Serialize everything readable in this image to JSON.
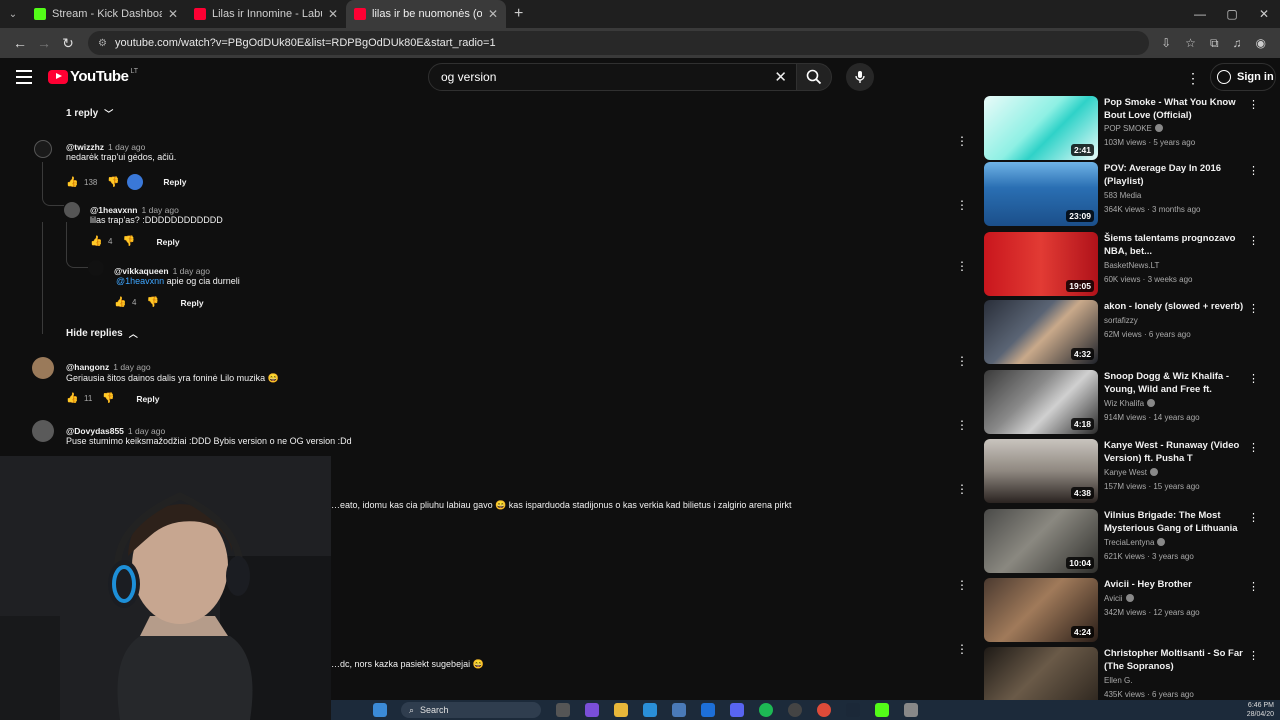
{
  "browser": {
    "tabs": [
      {
        "label": "Stream - Kick Dashboard",
        "fav_color": "#53fc18",
        "active": false
      },
      {
        "label": "Lilas ir Innomine - Labubu - You",
        "fav_color": "#ff0033",
        "active": false
      },
      {
        "label": "lilas ir be nuomonės (oficialus p",
        "fav_color": "#ff0033",
        "active": true
      }
    ],
    "url": "youtube.com/watch?v=PBgOdDUk80E&list=RDPBgOdDUk80E&start_radio=1"
  },
  "header": {
    "logo_text": "YouTube",
    "country_code": "LT",
    "search_value": "og version",
    "signin_label": "Sign in"
  },
  "comments": {
    "reply_toggle": "1 reply",
    "hide_replies": "Hide replies",
    "reply_label": "Reply",
    "items": [
      {
        "author": "@twizzhz",
        "time": "1 day ago",
        "text": "nedarėk trap'ui gėdos, ačiū.",
        "likes": "138"
      },
      {
        "author": "@1heavxnn",
        "time": "1 day ago",
        "text": "lilas trap'as? :DDDDDDDDDDDD",
        "likes": "4"
      },
      {
        "author": "@vikkaqueen",
        "time": "1 day ago",
        "mention": "@1heavxnn",
        "text": " apie og cia durneli",
        "likes": "4"
      },
      {
        "author": "@hangonz",
        "time": "1 day ago",
        "text": "Geriausia šitos dainos dalis yra foninė Lilo muzika 😄",
        "likes": "11"
      },
      {
        "author": "@Dovydas855",
        "time": "1 day ago",
        "text": "Puse stumimo keiksmažodžiai :DDD Bybis version o ne OG version :Dd"
      }
    ],
    "partial_1": "…eato, idomu kas cia pliuhu labiau gavo 😄 kas isparduoda stadijonus o kas verkia kad bilietus i zalgirio arena pirkt",
    "partial_2": "…dc, nors kazka pasiekt sugebejai 😄"
  },
  "sidebar": {
    "videos": [
      {
        "title": "Pop Smoke - What You Know Bout Love (Official)",
        "channel": "POP SMOKE",
        "verified": true,
        "meta": "103M views · 5 years ago",
        "duration": "2:41",
        "bg": "linear-gradient(135deg,#e9fbf9,#8ef0e4 45%,#2fd2c8 60%,#eafcfa)"
      },
      {
        "title": "POV: Average Day In 2016 (Playlist)",
        "channel": "583 Media",
        "verified": false,
        "meta": "364K views · 3 months ago",
        "duration": "23:09",
        "bg": "linear-gradient(180deg,#6fb3e6,#2a6fb3 40%,#1b4f8a)"
      },
      {
        "title": "Šiems talentams prognozavo NBA, bet...",
        "channel": "BasketNews.LT",
        "verified": false,
        "meta": "60K views · 3 weeks ago",
        "duration": "19:05",
        "bg": "linear-gradient(90deg,#c9161d,#e23b34 50%,#b0121a)"
      },
      {
        "title": "akon - lonely (slowed + reverb)",
        "channel": "sortafizzy",
        "verified": false,
        "meta": "62M views · 6 years ago",
        "duration": "4:32",
        "bg": "linear-gradient(135deg,#2a2f3a,#5a6474 40%,#c9a98a 55%,#1e222a)"
      },
      {
        "title": "Snoop Dogg & Wiz Khalifa - Young, Wild and Free ft. Bruno...",
        "channel": "Wiz Khalifa",
        "verified": true,
        "meta": "914M views · 14 years ago",
        "duration": "4:18",
        "bg": "linear-gradient(135deg,#3a3a3a,#8a8a8a 40%,#d0d0d0 60%,#2a2a2a)"
      },
      {
        "title": "Kanye West - Runaway (Video Version) ft. Pusha T",
        "channel": "Kanye West",
        "verified": true,
        "meta": "157M views · 15 years ago",
        "duration": "4:38",
        "bg": "linear-gradient(180deg,#c9c4be,#8f8880 50%,#2a2320)"
      },
      {
        "title": "Vilnius Brigade: The Most Mysterious Gang of Lithuania",
        "channel": "TreciaLentyna",
        "verified": true,
        "meta": "621K views · 3 years ago",
        "duration": "10:04",
        "bg": "linear-gradient(135deg,#4a4a48,#8a8880 45%,#2f2f2c)"
      },
      {
        "title": "Avicii - Hey Brother",
        "channel": "Avicii",
        "verified": true,
        "meta": "342M views · 12 years ago",
        "duration": "4:24",
        "bg": "linear-gradient(135deg,#4b3a30,#a07a5a 45%,#2a1e18)"
      },
      {
        "title": "Christopher Moltisanti - So Far (The Sopranos)",
        "channel": "Ellen G.",
        "verified": false,
        "meta": "435K views · 6 years ago",
        "duration": "",
        "bg": "linear-gradient(135deg,#1e1a16,#6a5a48 45%,#2a231c)"
      }
    ]
  },
  "taskbar": {
    "search_label": "Search",
    "time": "6:46 PM",
    "date": "28/04/20"
  }
}
